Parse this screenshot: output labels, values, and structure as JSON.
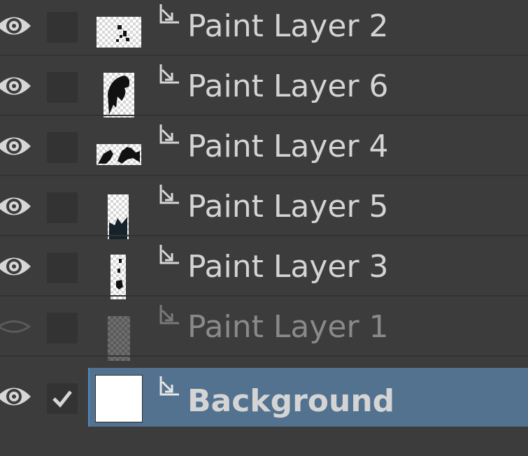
{
  "layers": [
    {
      "name": "Paint Layer 2",
      "visible": true,
      "checked": false,
      "selected": false
    },
    {
      "name": "Paint Layer 6",
      "visible": true,
      "checked": false,
      "selected": false
    },
    {
      "name": "Paint Layer 4",
      "visible": true,
      "checked": false,
      "selected": false
    },
    {
      "name": "Paint Layer 5",
      "visible": true,
      "checked": false,
      "selected": false
    },
    {
      "name": "Paint Layer 3",
      "visible": true,
      "checked": false,
      "selected": false
    },
    {
      "name": "Paint Layer 1",
      "visible": false,
      "checked": false,
      "selected": false
    },
    {
      "name": "Background",
      "visible": true,
      "checked": true,
      "selected": true
    }
  ],
  "colors": {
    "panel_bg": "#3c3c3c",
    "selection": "#52728f",
    "text": "#d4d4d4",
    "text_hidden": "#8a8a8a"
  },
  "icons": {
    "visibility_on": "eye-icon",
    "visibility_off": "eye-closed-icon",
    "clipping": "clipping-mask-icon",
    "checked": "checkmark-icon"
  }
}
